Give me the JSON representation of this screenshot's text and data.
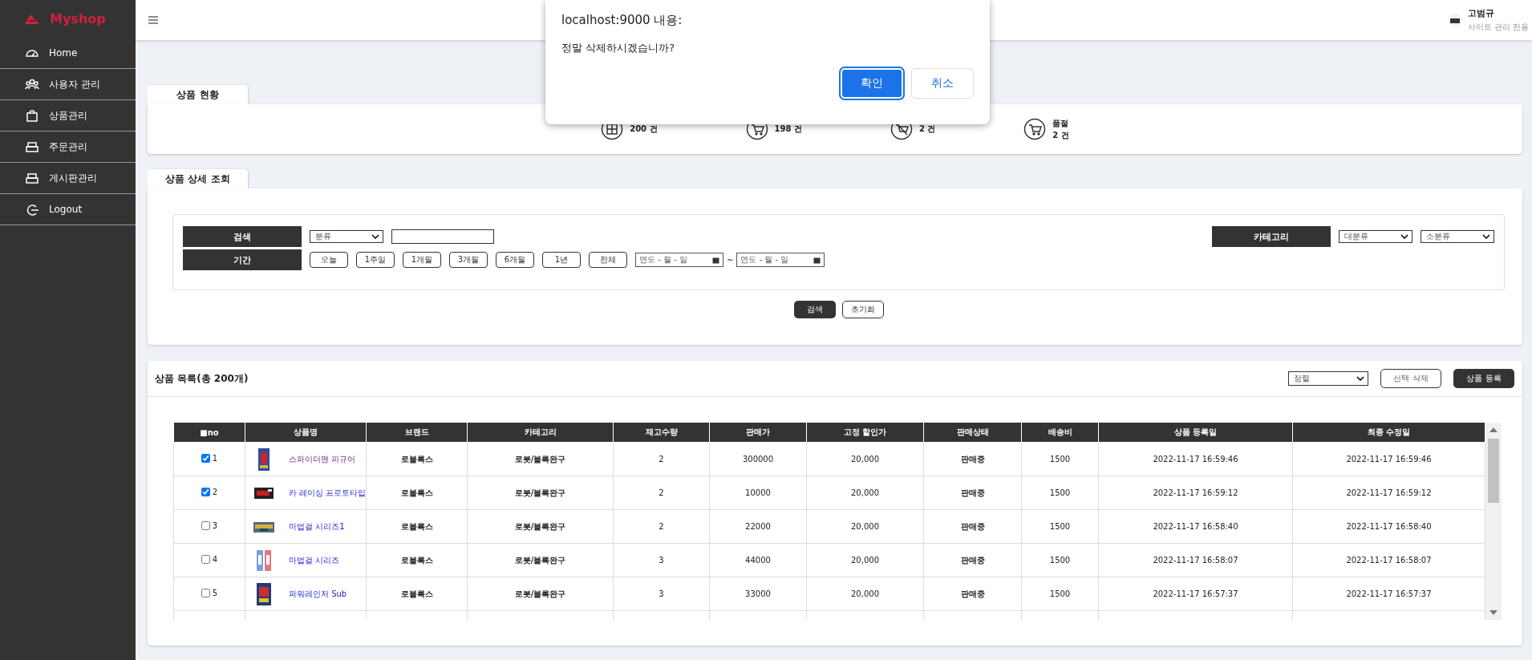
{
  "sidebar": {
    "logo": "Myshop",
    "items": [
      {
        "label": "Home",
        "kind": "gauge"
      },
      {
        "label": "사용자 관리",
        "kind": "users"
      },
      {
        "label": "상품관리",
        "kind": "bag"
      },
      {
        "label": "주문관리",
        "kind": "printer"
      },
      {
        "label": "게시판관리",
        "kind": "printer"
      },
      {
        "label": "Logout",
        "kind": "logout"
      }
    ]
  },
  "header": {
    "user_name": "고범규",
    "user_role": "사이트 관리 전용"
  },
  "dialog": {
    "title": "localhost:9000 내용:",
    "message": "정말 삭제하시겠습니까?",
    "buttons": [
      {
        "label": "확인",
        "kind": "primary"
      },
      {
        "label": "취소",
        "kind": "secondary"
      }
    ]
  },
  "status": {
    "tab": "상품 현황",
    "stats": [
      {
        "value": "200 건",
        "kind": "grid"
      },
      {
        "value": "198 건",
        "kind": "cart"
      },
      {
        "value": "2 건",
        "kind": "nocart"
      },
      {
        "label": "품절",
        "value": "2 건",
        "kind": "cart"
      }
    ]
  },
  "search": {
    "tab": "상품 상세 조회",
    "search_label": "검색",
    "type_select": "분류",
    "category_label": "카테고리",
    "category_selects": [
      "대분류",
      "소분류"
    ],
    "period_label": "기간",
    "period_buttons": [
      "오늘",
      "1주일",
      "1개월",
      "3개월",
      "6개월",
      "1년",
      "전체"
    ],
    "date_from": "연도 - 월 - 일",
    "date_sep": "~",
    "date_to": "연도 - 월 - 일",
    "submit": "검색",
    "reset": "초기화"
  },
  "product_list": {
    "title": "상품 목록(총 200개)",
    "sort_select": "정렬",
    "delete_button": "선택 삭제",
    "add_button": "상품 등록",
    "columns": [
      "■no",
      "상품명",
      "브랜드",
      "카테고리",
      "재고수량",
      "판매가",
      "고정 할인가",
      "판매상태",
      "배송비",
      "상품 등록일",
      "최종 수정일"
    ],
    "rows": [
      {
        "checked": true,
        "no": "1",
        "name": "스파이더맨 피규어",
        "visited": true,
        "brand": "로블록스",
        "category": "로봇/블록완구",
        "stock": "2",
        "price": "300000",
        "discount": "20,000",
        "state": "판매중",
        "shipping": "1500",
        "created": "2022-11-17 16:59:46",
        "modified": "2022-11-17 16:59:46"
      },
      {
        "checked": true,
        "no": "2",
        "name": "카 레이싱 프로토타입",
        "visited": false,
        "brand": "로블록스",
        "category": "로봇/블록완구",
        "stock": "2",
        "price": "10000",
        "discount": "20,000",
        "state": "판매중",
        "shipping": "1500",
        "created": "2022-11-17 16:59:12",
        "modified": "2022-11-17 16:59:12"
      },
      {
        "checked": false,
        "no": "3",
        "name": "마법걸 시리즈1",
        "visited": false,
        "brand": "로블록스",
        "category": "로봇/블록완구",
        "stock": "2",
        "price": "22000",
        "discount": "20,000",
        "state": "판매중",
        "shipping": "1500",
        "created": "2022-11-17 16:58:40",
        "modified": "2022-11-17 16:58:40"
      },
      {
        "checked": false,
        "no": "4",
        "name": "마법걸 시리즈",
        "visited": false,
        "brand": "로블록스",
        "category": "로봇/블록완구",
        "stock": "3",
        "price": "44000",
        "discount": "20,000",
        "state": "판매중",
        "shipping": "1500",
        "created": "2022-11-17 16:58:07",
        "modified": "2022-11-17 16:58:07"
      },
      {
        "checked": false,
        "no": "5",
        "name": "파워레인저 Sub",
        "visited": false,
        "brand": "로블록스",
        "category": "로봇/블록완구",
        "stock": "3",
        "price": "33000",
        "discount": "20,000",
        "state": "판매중",
        "shipping": "1500",
        "created": "2022-11-17 16:57:37",
        "modified": "2022-11-17 16:57:37"
      }
    ]
  }
}
